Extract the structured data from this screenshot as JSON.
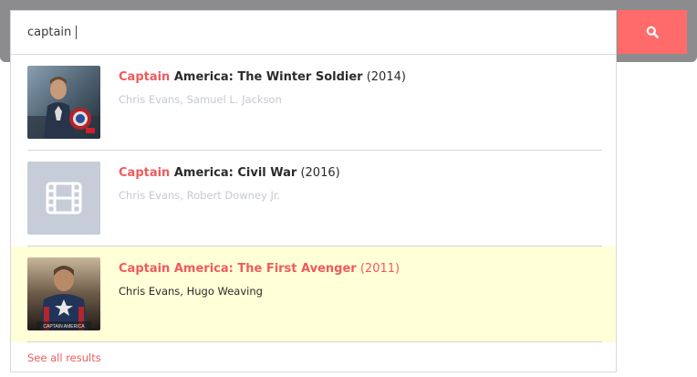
{
  "search": {
    "query": "captain",
    "button_icon": "search-icon",
    "button_color": "#ff6b6b"
  },
  "results": [
    {
      "title_match": "Captain",
      "title_rest": " America: The Winter Soldier",
      "year": " (2014)",
      "cast": "Chris Evans, Samuel L. Jackson",
      "thumbnail": "movie-poster-winter-soldier",
      "highlighted": false
    },
    {
      "title_match": "Captain",
      "title_rest": " America: Civil War",
      "year": " (2016)",
      "cast": "Chris Evans, Robert Downey Jr.",
      "thumbnail": "film-placeholder-icon",
      "highlighted": false
    },
    {
      "title_match": "Captain",
      "title_rest": " America: The First Avenger",
      "year": " (2011)",
      "cast": "Chris Evans, Hugo Weaving",
      "thumbnail": "movie-poster-first-avenger",
      "highlighted": true
    }
  ],
  "see_all_label": "See all results",
  "colors": {
    "accent": "#f05b5b",
    "highlight_bg": "#ffffd8",
    "muted_text": "#c4c8d4"
  }
}
